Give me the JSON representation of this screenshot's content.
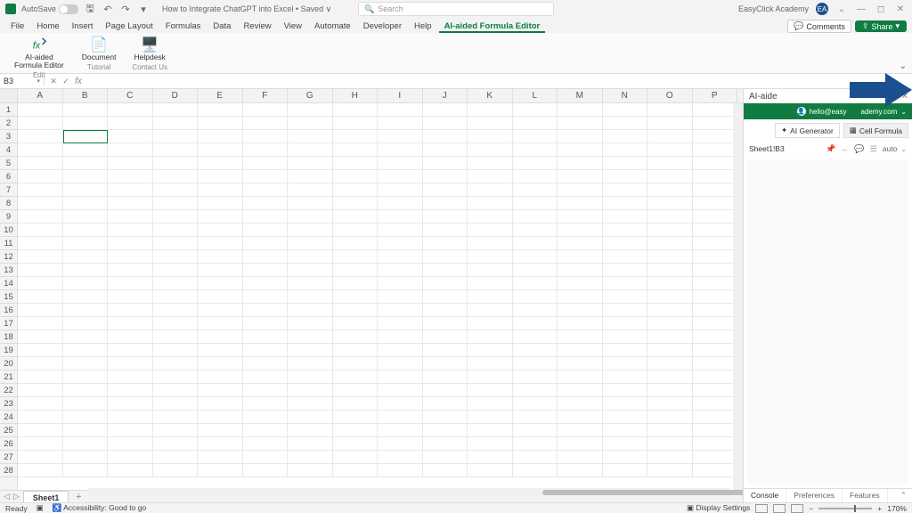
{
  "titlebar": {
    "autosave_label": "AutoSave",
    "doc_title": "How to Integrate ChatGPT into Excel • Saved ∨",
    "search_placeholder": "Search",
    "account_name": "EasyClick Academy",
    "avatar_initials": "EA"
  },
  "tabs": [
    "File",
    "Home",
    "Insert",
    "Page Layout",
    "Formulas",
    "Data",
    "Review",
    "View",
    "Automate",
    "Developer",
    "Help",
    "AI-aided Formula Editor"
  ],
  "active_tab_index": 11,
  "comments_label": "Comments",
  "share_label": "Share",
  "ribbon": {
    "groups": [
      {
        "label": "Edit",
        "buttons": [
          {
            "label": "AI-aided\nFormula Editor",
            "icon": "fx"
          }
        ]
      },
      {
        "label": "Tutorial",
        "buttons": [
          {
            "label": "Document",
            "icon": "doc"
          }
        ]
      },
      {
        "label": "Contact Us",
        "buttons": [
          {
            "label": "Helpdesk",
            "icon": "help"
          }
        ]
      }
    ]
  },
  "namebox": "B3",
  "columns": [
    "A",
    "B",
    "C",
    "D",
    "E",
    "F",
    "G",
    "H",
    "I",
    "J",
    "K",
    "L",
    "M",
    "N",
    "O",
    "P"
  ],
  "row_count": 28,
  "sheet_name": "Sheet1",
  "status": {
    "ready": "Ready",
    "accessibility": "Accessibility: Good to go",
    "display_settings": "Display Settings",
    "zoom": "170%"
  },
  "pane": {
    "title": "AI-aide",
    "email": "hello@easy  ademy.com",
    "tabs": [
      {
        "label": "AI Generator",
        "icon": "✦"
      },
      {
        "label": "Cell Formula",
        "icon": "▦"
      }
    ],
    "active_tab": 1,
    "ref": "Sheet1!B3",
    "auto_label": "auto",
    "bottom_tabs": [
      "Console",
      "Preferences",
      "Features"
    ]
  }
}
